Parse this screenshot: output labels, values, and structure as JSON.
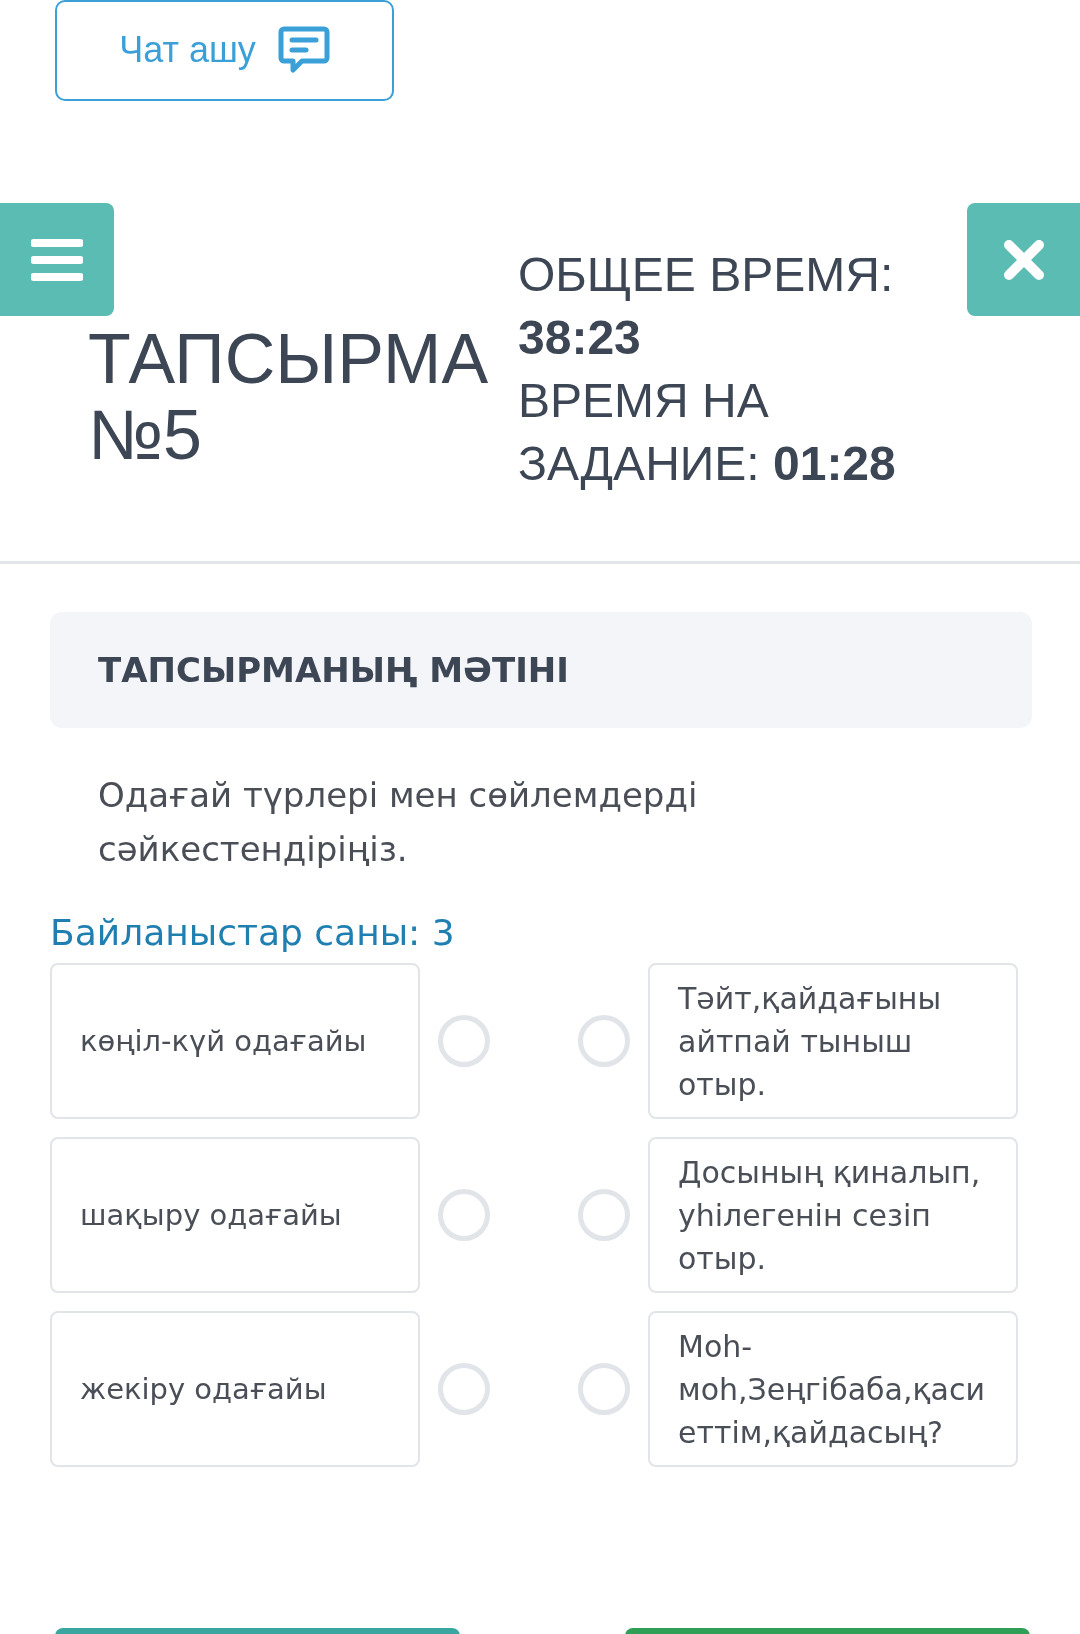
{
  "chat_button": {
    "label": "Чат ашу"
  },
  "title": "ТАПСЫРМА\n№5",
  "timers": [
    {
      "label": "ОБЩЕЕ ВРЕМЯ:",
      "value": "38:23"
    },
    {
      "label": "ВРЕМЯ НА ЗАДАНИЕ:",
      "value": "01:28"
    }
  ],
  "task_header": "ТАПСЫРМАНЫҢ МӘТІНІ",
  "instruction": "Одағай түрлері мен сөйлемдерді сәйкестендіріңіз.",
  "connections_count": "Байланыстар саны: 3",
  "left_items": [
    "көңіл-күй одағайы",
    "шақыру одағайы",
    "жекіру одағайы"
  ],
  "right_items": [
    "Тәйт,қайдағыны айтпай тыныш отыр.",
    "Досының қиналып, уһілегенін сезіп отыр.",
    "Моһ-моһ,Зеңгібаба,қаси еттім,қайдасың?"
  ],
  "footer_buttons": [
    {
      "color": "#3aa6a0"
    },
    {
      "color": "#2f9e57"
    }
  ]
}
